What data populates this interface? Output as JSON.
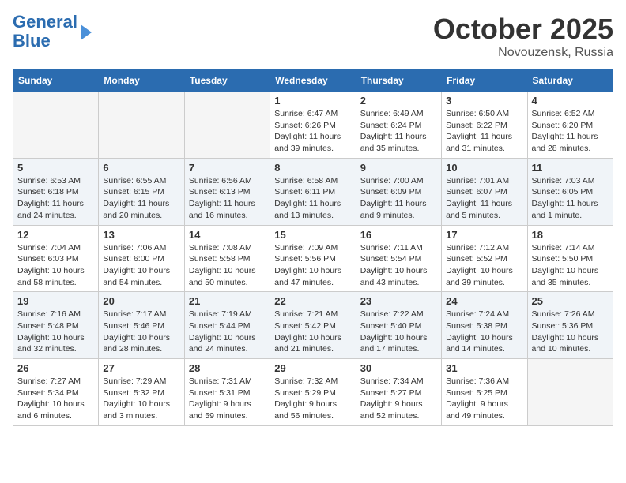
{
  "logo": {
    "line1": "General",
    "line2": "Blue"
  },
  "title": "October 2025",
  "location": "Novouzensk, Russia",
  "days_of_week": [
    "Sunday",
    "Monday",
    "Tuesday",
    "Wednesday",
    "Thursday",
    "Friday",
    "Saturday"
  ],
  "weeks": [
    [
      {
        "num": "",
        "info": ""
      },
      {
        "num": "",
        "info": ""
      },
      {
        "num": "",
        "info": ""
      },
      {
        "num": "1",
        "info": "Sunrise: 6:47 AM\nSunset: 6:26 PM\nDaylight: 11 hours\nand 39 minutes."
      },
      {
        "num": "2",
        "info": "Sunrise: 6:49 AM\nSunset: 6:24 PM\nDaylight: 11 hours\nand 35 minutes."
      },
      {
        "num": "3",
        "info": "Sunrise: 6:50 AM\nSunset: 6:22 PM\nDaylight: 11 hours\nand 31 minutes."
      },
      {
        "num": "4",
        "info": "Sunrise: 6:52 AM\nSunset: 6:20 PM\nDaylight: 11 hours\nand 28 minutes."
      }
    ],
    [
      {
        "num": "5",
        "info": "Sunrise: 6:53 AM\nSunset: 6:18 PM\nDaylight: 11 hours\nand 24 minutes."
      },
      {
        "num": "6",
        "info": "Sunrise: 6:55 AM\nSunset: 6:15 PM\nDaylight: 11 hours\nand 20 minutes."
      },
      {
        "num": "7",
        "info": "Sunrise: 6:56 AM\nSunset: 6:13 PM\nDaylight: 11 hours\nand 16 minutes."
      },
      {
        "num": "8",
        "info": "Sunrise: 6:58 AM\nSunset: 6:11 PM\nDaylight: 11 hours\nand 13 minutes."
      },
      {
        "num": "9",
        "info": "Sunrise: 7:00 AM\nSunset: 6:09 PM\nDaylight: 11 hours\nand 9 minutes."
      },
      {
        "num": "10",
        "info": "Sunrise: 7:01 AM\nSunset: 6:07 PM\nDaylight: 11 hours\nand 5 minutes."
      },
      {
        "num": "11",
        "info": "Sunrise: 7:03 AM\nSunset: 6:05 PM\nDaylight: 11 hours\nand 1 minute."
      }
    ],
    [
      {
        "num": "12",
        "info": "Sunrise: 7:04 AM\nSunset: 6:03 PM\nDaylight: 10 hours\nand 58 minutes."
      },
      {
        "num": "13",
        "info": "Sunrise: 7:06 AM\nSunset: 6:00 PM\nDaylight: 10 hours\nand 54 minutes."
      },
      {
        "num": "14",
        "info": "Sunrise: 7:08 AM\nSunset: 5:58 PM\nDaylight: 10 hours\nand 50 minutes."
      },
      {
        "num": "15",
        "info": "Sunrise: 7:09 AM\nSunset: 5:56 PM\nDaylight: 10 hours\nand 47 minutes."
      },
      {
        "num": "16",
        "info": "Sunrise: 7:11 AM\nSunset: 5:54 PM\nDaylight: 10 hours\nand 43 minutes."
      },
      {
        "num": "17",
        "info": "Sunrise: 7:12 AM\nSunset: 5:52 PM\nDaylight: 10 hours\nand 39 minutes."
      },
      {
        "num": "18",
        "info": "Sunrise: 7:14 AM\nSunset: 5:50 PM\nDaylight: 10 hours\nand 35 minutes."
      }
    ],
    [
      {
        "num": "19",
        "info": "Sunrise: 7:16 AM\nSunset: 5:48 PM\nDaylight: 10 hours\nand 32 minutes."
      },
      {
        "num": "20",
        "info": "Sunrise: 7:17 AM\nSunset: 5:46 PM\nDaylight: 10 hours\nand 28 minutes."
      },
      {
        "num": "21",
        "info": "Sunrise: 7:19 AM\nSunset: 5:44 PM\nDaylight: 10 hours\nand 24 minutes."
      },
      {
        "num": "22",
        "info": "Sunrise: 7:21 AM\nSunset: 5:42 PM\nDaylight: 10 hours\nand 21 minutes."
      },
      {
        "num": "23",
        "info": "Sunrise: 7:22 AM\nSunset: 5:40 PM\nDaylight: 10 hours\nand 17 minutes."
      },
      {
        "num": "24",
        "info": "Sunrise: 7:24 AM\nSunset: 5:38 PM\nDaylight: 10 hours\nand 14 minutes."
      },
      {
        "num": "25",
        "info": "Sunrise: 7:26 AM\nSunset: 5:36 PM\nDaylight: 10 hours\nand 10 minutes."
      }
    ],
    [
      {
        "num": "26",
        "info": "Sunrise: 7:27 AM\nSunset: 5:34 PM\nDaylight: 10 hours\nand 6 minutes."
      },
      {
        "num": "27",
        "info": "Sunrise: 7:29 AM\nSunset: 5:32 PM\nDaylight: 10 hours\nand 3 minutes."
      },
      {
        "num": "28",
        "info": "Sunrise: 7:31 AM\nSunset: 5:31 PM\nDaylight: 9 hours\nand 59 minutes."
      },
      {
        "num": "29",
        "info": "Sunrise: 7:32 AM\nSunset: 5:29 PM\nDaylight: 9 hours\nand 56 minutes."
      },
      {
        "num": "30",
        "info": "Sunrise: 7:34 AM\nSunset: 5:27 PM\nDaylight: 9 hours\nand 52 minutes."
      },
      {
        "num": "31",
        "info": "Sunrise: 7:36 AM\nSunset: 5:25 PM\nDaylight: 9 hours\nand 49 minutes."
      },
      {
        "num": "",
        "info": ""
      }
    ]
  ]
}
